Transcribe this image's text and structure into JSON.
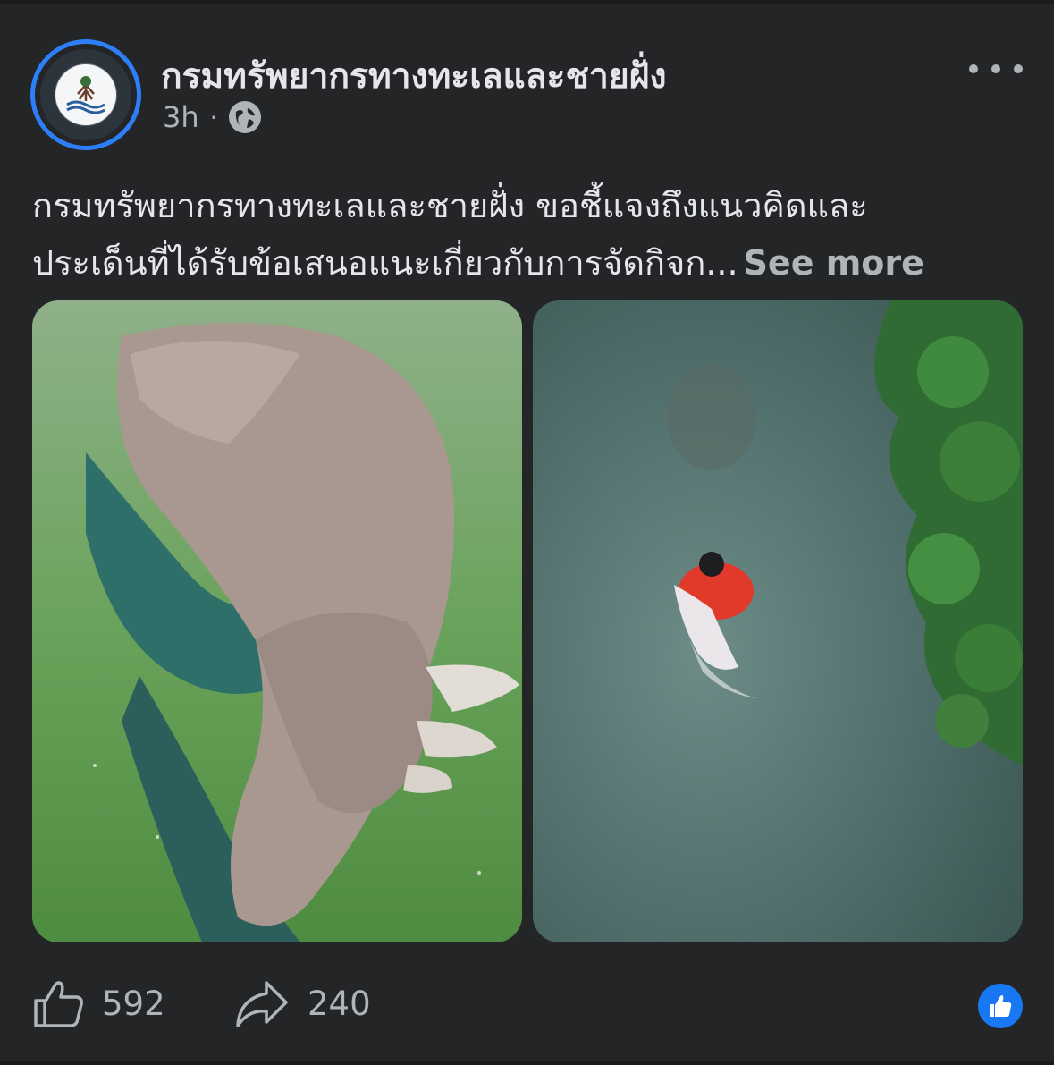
{
  "post": {
    "page_name": "กรมทรัพยากรทางทะเลและชายฝั่ง",
    "time": "3h",
    "separator": "·",
    "privacy_icon": "globe-icon",
    "caption_line1": "กรมทรัพยากรทางทะเลและชายฝั่ง ขอชี้แจงถึงแนวคิดและ",
    "caption_line2": "ประเด็นที่ได้รับข้อเสนอแนะเกี่ยวกับการจัดกิจก...",
    "see_more": "See more"
  },
  "photos": [
    {
      "name": "photo-dugong-underwater"
    },
    {
      "name": "photo-aerial-rescuer"
    }
  ],
  "footer": {
    "like_count": "592",
    "share_count": "240",
    "like_icon": "thumbs-up-icon",
    "share_icon": "share-arrow-icon",
    "reaction_icon": "like-reaction-icon"
  },
  "colors": {
    "background": "#242526",
    "text": "#e4e6eb",
    "secondary_text": "#b0b3b8",
    "accent": "#1877f2",
    "avatar_ring": "#2d7ff9"
  }
}
